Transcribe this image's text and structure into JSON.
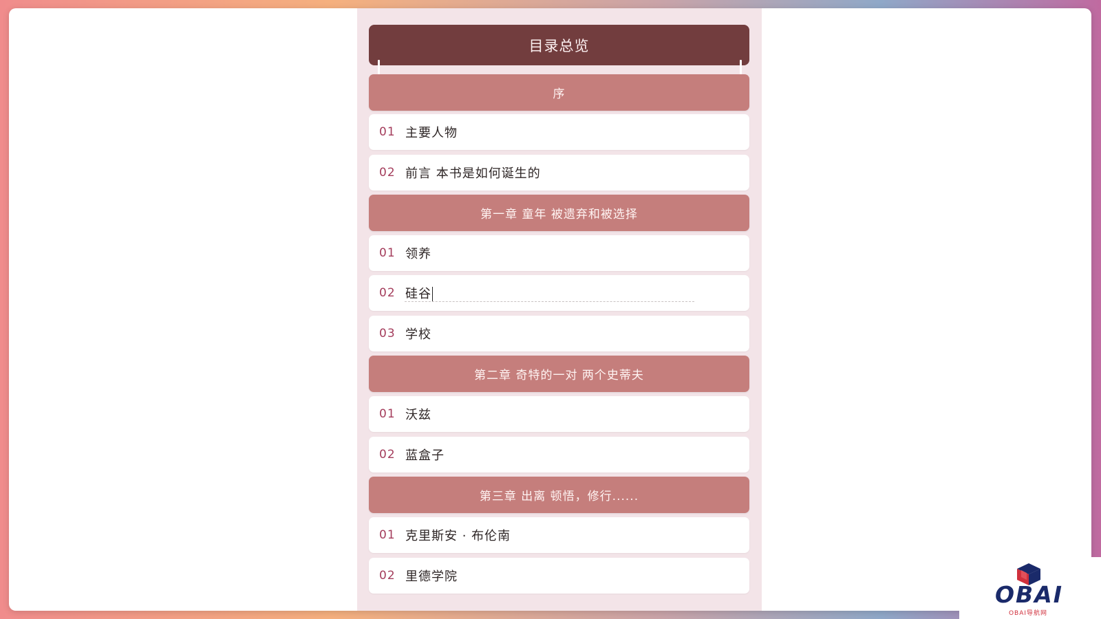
{
  "toc": {
    "title": "目录总览",
    "sections": [
      {
        "title": "序",
        "items": [
          {
            "num": "01",
            "text": "主要人物"
          },
          {
            "num": "02",
            "text": "前言 本书是如何诞生的"
          }
        ]
      },
      {
        "title": "第一章 童年 被遗弃和被选择",
        "items": [
          {
            "num": "01",
            "text": "领养"
          },
          {
            "num": "02",
            "text": "硅谷"
          },
          {
            "num": "03",
            "text": "学校"
          }
        ]
      },
      {
        "title": "第二章 奇特的一对 两个史蒂夫",
        "items": [
          {
            "num": "01",
            "text": "沃兹"
          },
          {
            "num": "02",
            "text": "蓝盒子"
          }
        ]
      },
      {
        "title": "第三章 出离 顿悟，修行......",
        "items": [
          {
            "num": "01",
            "text": "克里斯安 · 布伦南"
          },
          {
            "num": "02",
            "text": "里德学院"
          }
        ]
      }
    ]
  },
  "brand": {
    "logo_text": "OBAI",
    "tagline": "OBAI导航网",
    "colors": {
      "navy": "#1a2a6a",
      "red": "#d0303c"
    }
  },
  "colors": {
    "header": "#723d3e",
    "chapter": "#c57e7c",
    "panel": "#f3e4e8",
    "number": "#a43d5c"
  }
}
